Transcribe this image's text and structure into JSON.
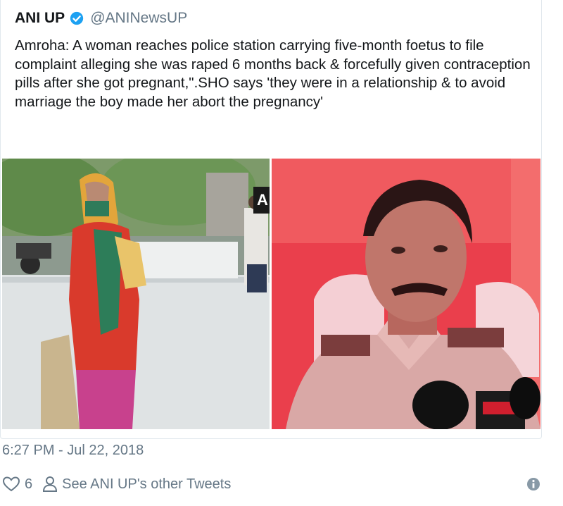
{
  "tweet": {
    "display_name": "ANI UP",
    "handle": "@ANINewsUP",
    "text": "Amroha: A woman reaches police station carrying five-month foetus to file complaint alleging she was raped 6 months back & forcefully given contraception pills after she got pregnant,\".SHO says 'they were in a relationship & to avoid marriage the boy made her abort the pregnancy'",
    "timestamp": "6:27 PM - Jul 22, 2018",
    "like_count": "6",
    "other_tweets_label": "See ANI UP's other Tweets",
    "media_badge": "A"
  },
  "icons": {
    "verified": "verified-badge-icon",
    "like": "heart-icon",
    "profile": "person-icon",
    "info": "info-icon"
  },
  "colors": {
    "verified_blue": "#1da1f2",
    "secondary_text": "#657786",
    "right_photo_bg": "#e83b49"
  }
}
